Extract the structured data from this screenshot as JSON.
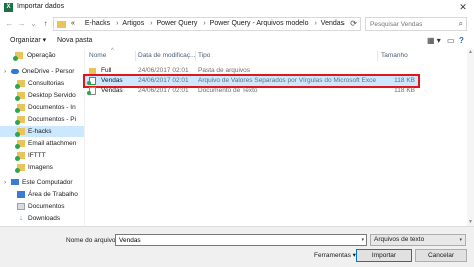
{
  "window": {
    "title": "Importar dados",
    "app_icon_letter": "X",
    "close_glyph": "✕"
  },
  "address": {
    "back_glyph": "←",
    "forward_glyph": "→",
    "dropdown_glyph": "⌄",
    "up_glyph": "↑",
    "prefix": "«",
    "crumbs": [
      "E-hacks",
      "Artigos",
      "Power Query",
      "Power Query - Arquivos modelo",
      "Vendas"
    ],
    "separator": "›",
    "refresh_glyph": "⟳",
    "search_placeholder": "Pesquisar Vendas",
    "search_glyph": "⌕"
  },
  "toolbar": {
    "organize": "Organizar ▾",
    "new_folder": "Nova pasta",
    "view_glyph": "▦ ▾",
    "pane_glyph": "▭",
    "help_glyph": "?"
  },
  "nav": [
    {
      "label": "Operação",
      "icon": "folder-icon",
      "badge": true
    },
    {
      "label": "OneDrive - Persor",
      "icon": "onedrive-icon",
      "badge": false,
      "expander": "›"
    },
    {
      "label": "Consultorias",
      "icon": "folder-icon",
      "badge": true
    },
    {
      "label": "Desktop Servido",
      "icon": "folder-icon",
      "badge": true
    },
    {
      "label": "Documentos - In",
      "icon": "folder-icon",
      "badge": true
    },
    {
      "label": "Documentos - Pi",
      "icon": "folder-icon",
      "badge": true
    },
    {
      "label": "E-hacks",
      "icon": "folder-icon",
      "badge": true,
      "selected": true
    },
    {
      "label": "Email attachmen",
      "icon": "folder-icon",
      "badge": true
    },
    {
      "label": "IFTTT",
      "icon": "folder-icon",
      "badge": true
    },
    {
      "label": "Imagens",
      "icon": "folder-icon",
      "badge": true
    },
    {
      "label": "",
      "icon": "",
      "badge": false
    },
    {
      "label": "Este Computador",
      "icon": "computer-icon",
      "badge": false,
      "expander": "›"
    },
    {
      "label": "Área de Trabalho",
      "icon": "desktop-icon",
      "badge": false
    },
    {
      "label": "Documentos",
      "icon": "documents-icon",
      "badge": false
    },
    {
      "label": "Downloads",
      "icon": "downloads-icon",
      "badge": false
    }
  ],
  "columns": {
    "name": "Nome",
    "sort_glyph": "^",
    "date": "Data de modificaç...",
    "type": "Tipo",
    "size": "Tamanho"
  },
  "files": [
    {
      "name": "Full",
      "date": "24/06/2017 02:01",
      "type": "Pasta de arquivos",
      "size": "",
      "icon": "folder-icon",
      "selected": false
    },
    {
      "name": "Vendas",
      "date": "24/06/2017 02:01",
      "type": "Arquivo de Valores Separados por Vírgulas do Microsoft Excel",
      "size": "118 KB",
      "icon": "csv-file-icon",
      "selected": true
    },
    {
      "name": "Vendas",
      "date": "24/06/2017 02:01",
      "type": "Documento de Texto",
      "size": "118 KB",
      "icon": "text-file-icon",
      "selected": false
    }
  ],
  "bottom": {
    "filename_label": "Nome do arquivo:",
    "filename_value": "Vendas",
    "filetype_value": "Arquivos de texto",
    "dropdown_glyph": "▾",
    "tools_label": "Ferramentas ▾",
    "import_label": "Importar",
    "cancel_label": "Cancelar"
  },
  "colors": {
    "selection": "#cce8ff",
    "highlight_border": "#e0161b",
    "folder": "#e8c45a",
    "sync_badge": "#2da44e"
  }
}
